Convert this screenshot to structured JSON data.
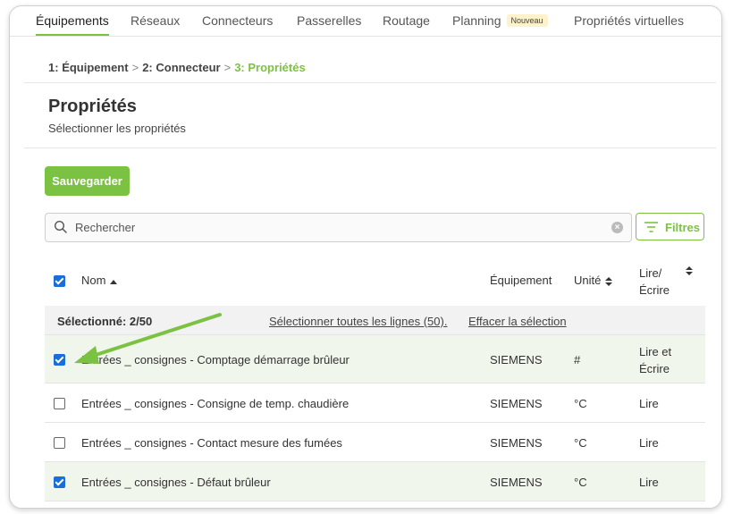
{
  "nav": {
    "tabs": [
      {
        "label": "Équipements",
        "active": true
      },
      {
        "label": "Réseaux"
      },
      {
        "label": "Connecteurs"
      },
      {
        "label": "Passerelles"
      },
      {
        "label": "Routage"
      },
      {
        "label": "Planning",
        "badge": "Nouveau"
      },
      {
        "label": "Propriétés virtuelles"
      }
    ]
  },
  "breadcrumb": {
    "steps": [
      {
        "num": "1:",
        "label": "Équipement"
      },
      {
        "num": "2:",
        "label": "Connecteur"
      },
      {
        "num": "3:",
        "label": "Propriétés"
      }
    ],
    "separator": ">"
  },
  "page": {
    "title": "Propriétés",
    "subtitle": "Sélectionner les propriétés"
  },
  "actions": {
    "save_label": "Sauvegarder",
    "filter_label": "Filtres"
  },
  "search": {
    "placeholder": "Rechercher"
  },
  "table": {
    "columns": {
      "name": "Nom",
      "equipment": "Équipement",
      "unit": "Unité",
      "rw_line1": "Lire/",
      "rw_line2": "Écrire"
    },
    "selection": {
      "count_text": "Sélectionné: 2/50",
      "select_all": "Sélectionner toutes les lignes (50).",
      "clear": "Effacer la sélection"
    },
    "rows": [
      {
        "name": "Entrées _ consignes - Comptage démarrage brûleur",
        "equipment": "SIEMENS",
        "unit": "#",
        "rw_line1": "Lire et",
        "rw_line2": "Écrire",
        "checked": true
      },
      {
        "name": "Entrées _ consignes - Consigne de temp. chaudière",
        "equipment": "SIEMENS",
        "unit": "°C",
        "rw_line1": "Lire",
        "rw_line2": "",
        "checked": false
      },
      {
        "name": "Entrées _ consignes - Contact mesure des fumées",
        "equipment": "SIEMENS",
        "unit": "°C",
        "rw_line1": "Lire",
        "rw_line2": "",
        "checked": false
      },
      {
        "name": "Entrées _ consignes - Défaut brûleur",
        "equipment": "SIEMENS",
        "unit": "°C",
        "rw_line1": "Lire",
        "rw_line2": "",
        "checked": true
      }
    ]
  },
  "colors": {
    "accent": "#7cc242",
    "checkbox": "#1a6ed8",
    "selected_row": "#f1f6ec"
  },
  "icons": {
    "search": "search-icon",
    "clear": "clear-icon",
    "filter": "filter-icon",
    "sort": "sort-icon",
    "annotation": "annotation-arrow-icon"
  }
}
